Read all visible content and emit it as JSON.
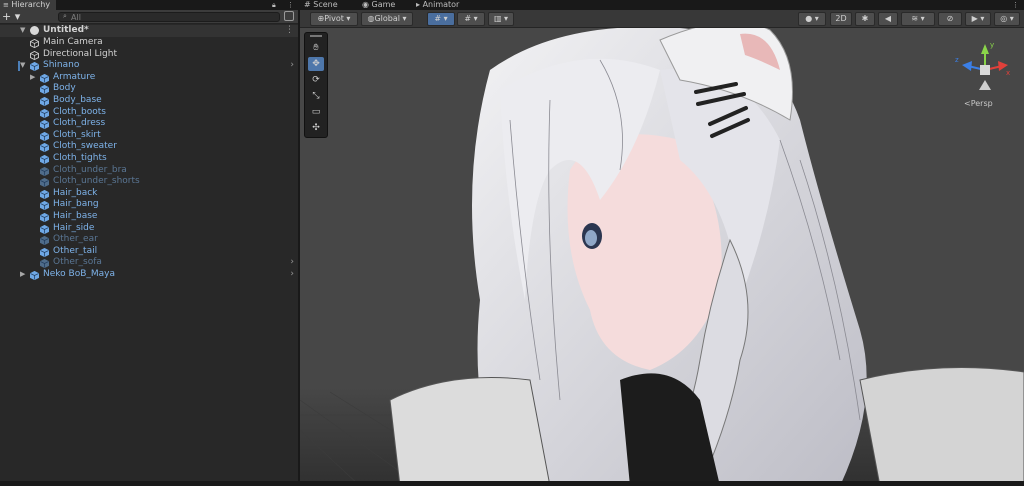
{
  "hierarchy": {
    "tab_label": "Hierarchy",
    "add_label": "+ ▾",
    "search_placeholder": "All",
    "scene_name": "Untitled*",
    "items": [
      {
        "label": "Main Camera",
        "style": "white",
        "depth": 1
      },
      {
        "label": "Directional Light",
        "style": "white",
        "depth": 1
      },
      {
        "label": "Shinano",
        "style": "blue",
        "depth": 1,
        "expanded": true,
        "has_children": true
      },
      {
        "label": "Armature",
        "style": "blue",
        "depth": 2,
        "has_children": true
      },
      {
        "label": "Body",
        "style": "blue",
        "depth": 2
      },
      {
        "label": "Body_base",
        "style": "blue",
        "depth": 2
      },
      {
        "label": "Cloth_boots",
        "style": "blue",
        "depth": 2
      },
      {
        "label": "Cloth_dress",
        "style": "blue",
        "depth": 2
      },
      {
        "label": "Cloth_skirt",
        "style": "blue",
        "depth": 2
      },
      {
        "label": "Cloth_sweater",
        "style": "blue",
        "depth": 2
      },
      {
        "label": "Cloth_tights",
        "style": "blue",
        "depth": 2
      },
      {
        "label": "Cloth_under_bra",
        "style": "dim",
        "depth": 2
      },
      {
        "label": "Cloth_under_shorts",
        "style": "dim",
        "depth": 2
      },
      {
        "label": "Hair_back",
        "style": "blue",
        "depth": 2
      },
      {
        "label": "Hair_bang",
        "style": "blue",
        "depth": 2
      },
      {
        "label": "Hair_base",
        "style": "blue",
        "depth": 2
      },
      {
        "label": "Hair_side",
        "style": "blue",
        "depth": 2
      },
      {
        "label": "Other_ear",
        "style": "dim",
        "depth": 2
      },
      {
        "label": "Other_tail",
        "style": "blue",
        "depth": 2
      },
      {
        "label": "Other_sofa",
        "style": "dim",
        "depth": 2
      },
      {
        "label": "Neko BoB_Maya",
        "style": "blue",
        "depth": 1,
        "has_children": true
      }
    ]
  },
  "scene_view": {
    "tabs": [
      "Scene",
      "Game",
      "Animator"
    ],
    "pivot_label": "Pivot",
    "global_label": "Global",
    "mode_2d_label": "2D",
    "persp_label": "Persp",
    "gizmo_axes": {
      "x": "x",
      "y": "y",
      "z": "z"
    }
  },
  "colors": {
    "panel_bg": "#282828",
    "selection_blue": "#4e77ab",
    "prefab_blue": "#7eb3ea",
    "gizmo_x": "#e0403a",
    "gizmo_y": "#8ad54a",
    "gizmo_z": "#3b7fe6"
  }
}
